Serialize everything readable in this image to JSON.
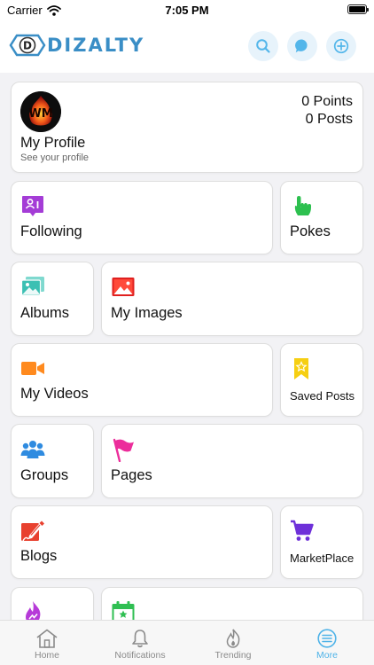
{
  "status_bar": {
    "carrier": "Carrier",
    "time": "7:05 PM"
  },
  "header": {
    "logo_text": "DIZALTY",
    "logo_letter": "D",
    "accent": "#3a8ec6"
  },
  "profile": {
    "avatar_text": "WM",
    "name": "My Profile",
    "subtitle": "See your profile",
    "points": "0 Points",
    "posts": "0 Posts"
  },
  "menu": {
    "following": "Following",
    "pokes": "Pokes",
    "albums": "Albums",
    "my_images": "My Images",
    "my_videos": "My Videos",
    "saved_posts": "Saved Posts",
    "groups": "Groups",
    "pages": "Pages",
    "blogs": "Blogs",
    "marketplace": "MarketPlace"
  },
  "tab_bar": {
    "home": "Home",
    "notifications": "Notifications",
    "trending": "Trending",
    "more": "More",
    "active": "More",
    "active_color": "#4fb3e8"
  },
  "icons": [
    "wifi-icon",
    "battery-icon",
    "search-icon",
    "chat-icon",
    "add-icon",
    "following-icon",
    "pokes-icon",
    "albums-icon",
    "my-images-icon",
    "my-videos-icon",
    "saved-posts-icon",
    "groups-icon",
    "pages-icon",
    "blogs-icon",
    "marketplace-icon",
    "trending-fire-icon",
    "calendar-icon",
    "home-icon",
    "bell-icon",
    "fire-icon",
    "more-icon"
  ]
}
